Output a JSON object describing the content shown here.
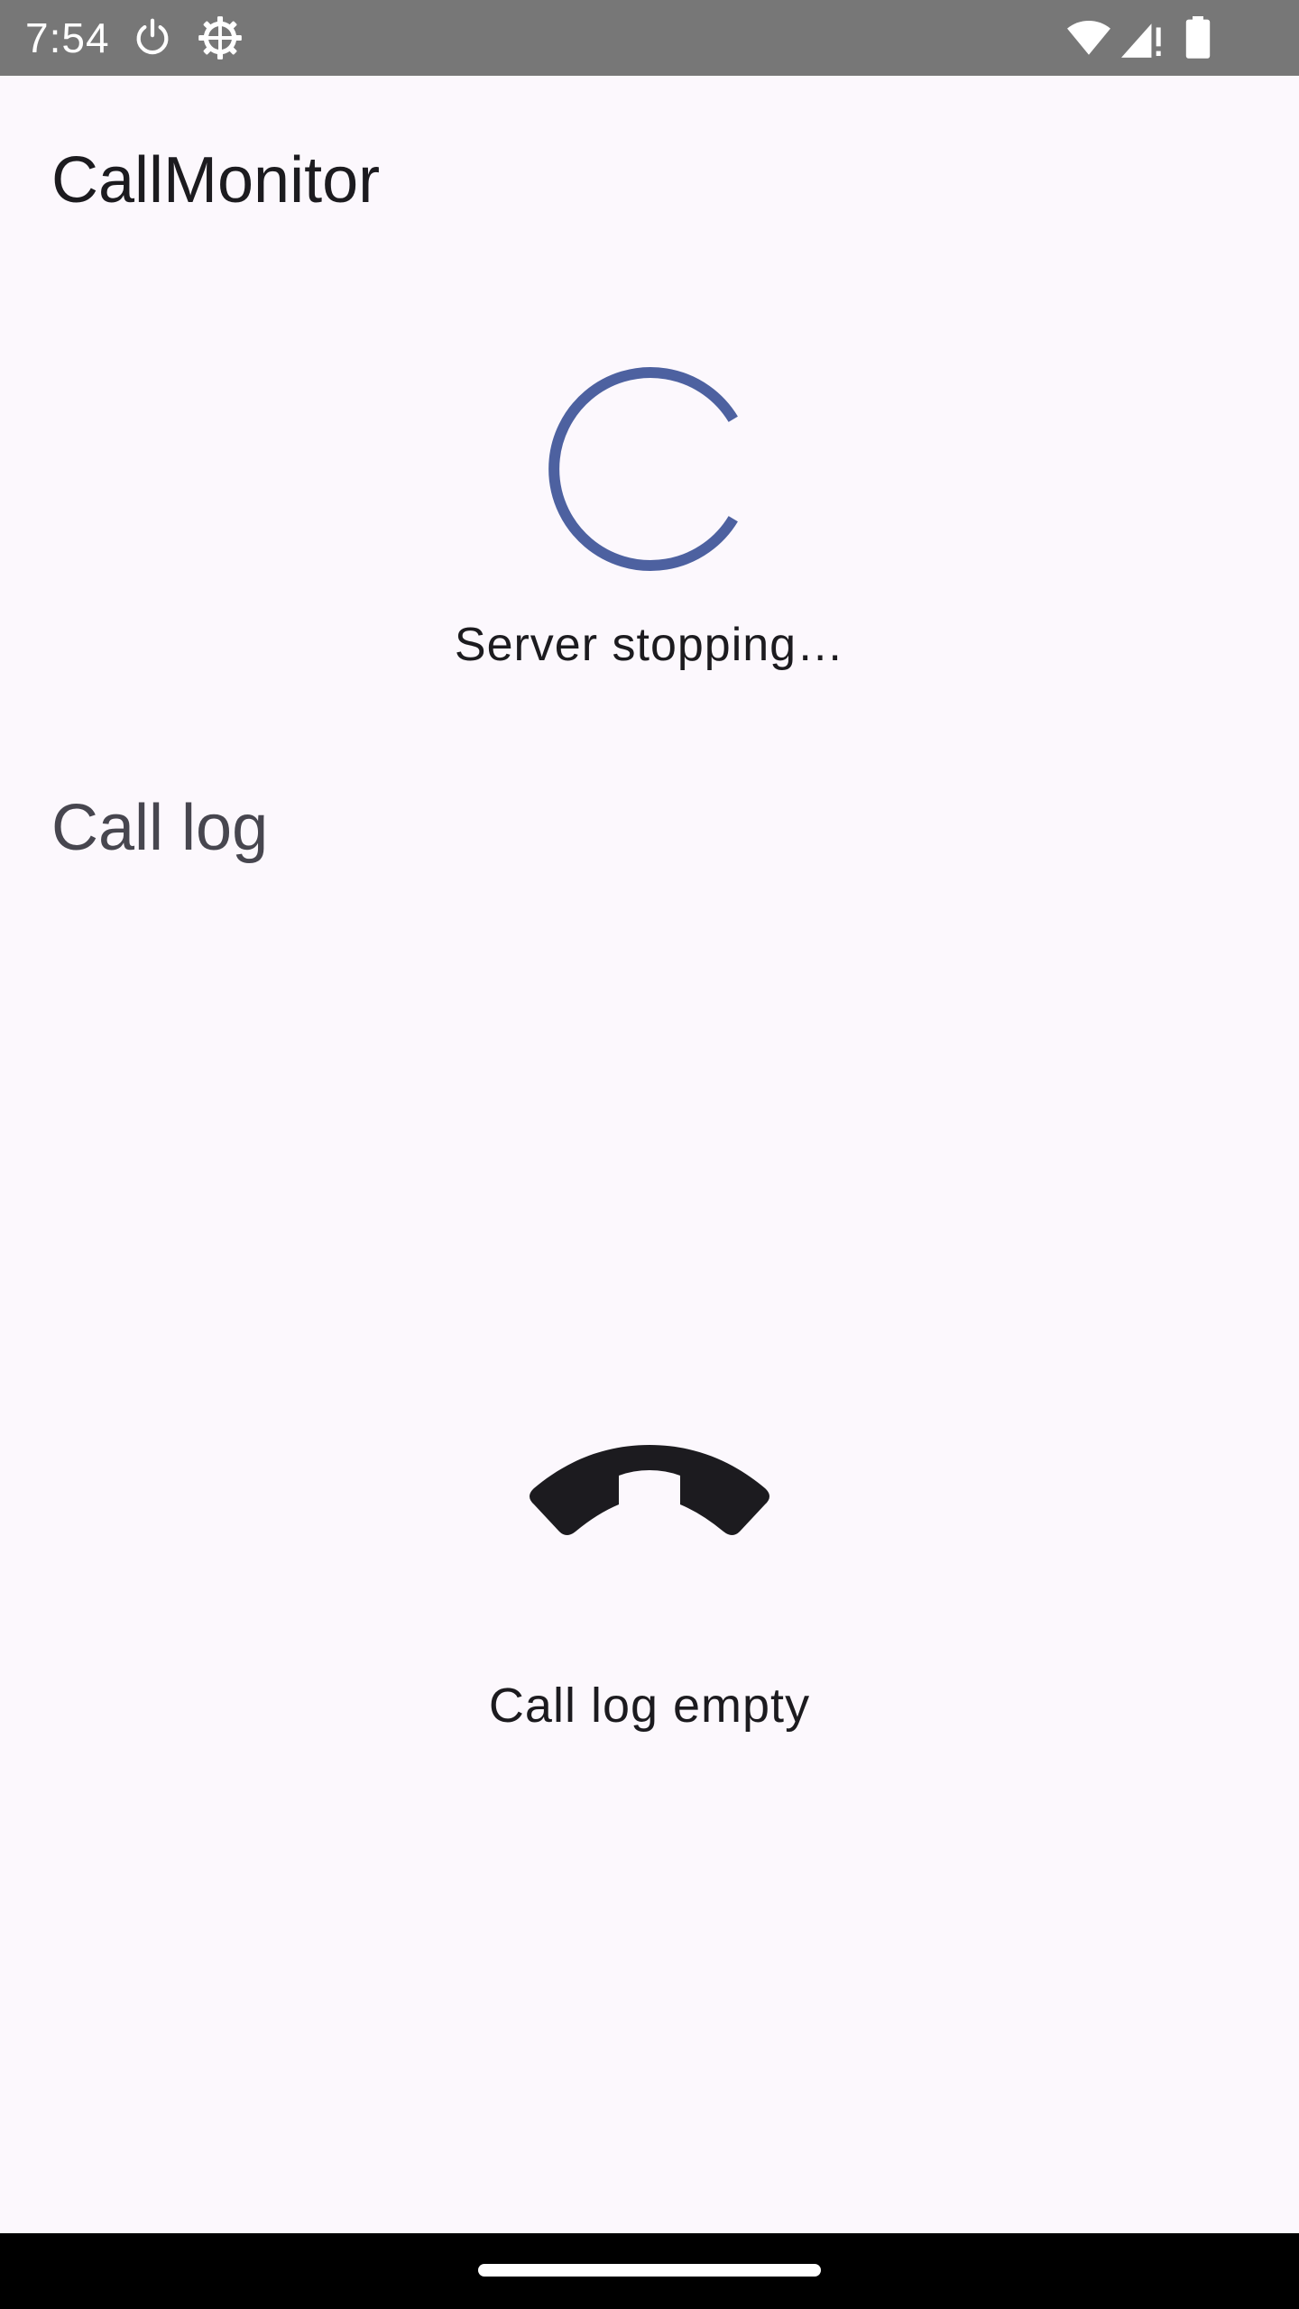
{
  "status_bar": {
    "time": "7:54",
    "icons": [
      "power-icon",
      "gear-icon",
      "wifi-icon",
      "signal-icon",
      "battery-icon"
    ]
  },
  "app_bar": {
    "title": "CallMonitor"
  },
  "server": {
    "status_text": "Server stopping…",
    "indicator": "spinner-icon",
    "accent_color": "#4d61a0"
  },
  "call_log": {
    "title": "Call log",
    "empty_icon": "call-end-icon",
    "empty_text": "Call log empty"
  },
  "colors": {
    "background": "#fcf8fd",
    "status_bar": "#777777",
    "text_primary": "#1c1b1f",
    "text_secondary": "#47464f",
    "nav_bar": "#000000"
  }
}
